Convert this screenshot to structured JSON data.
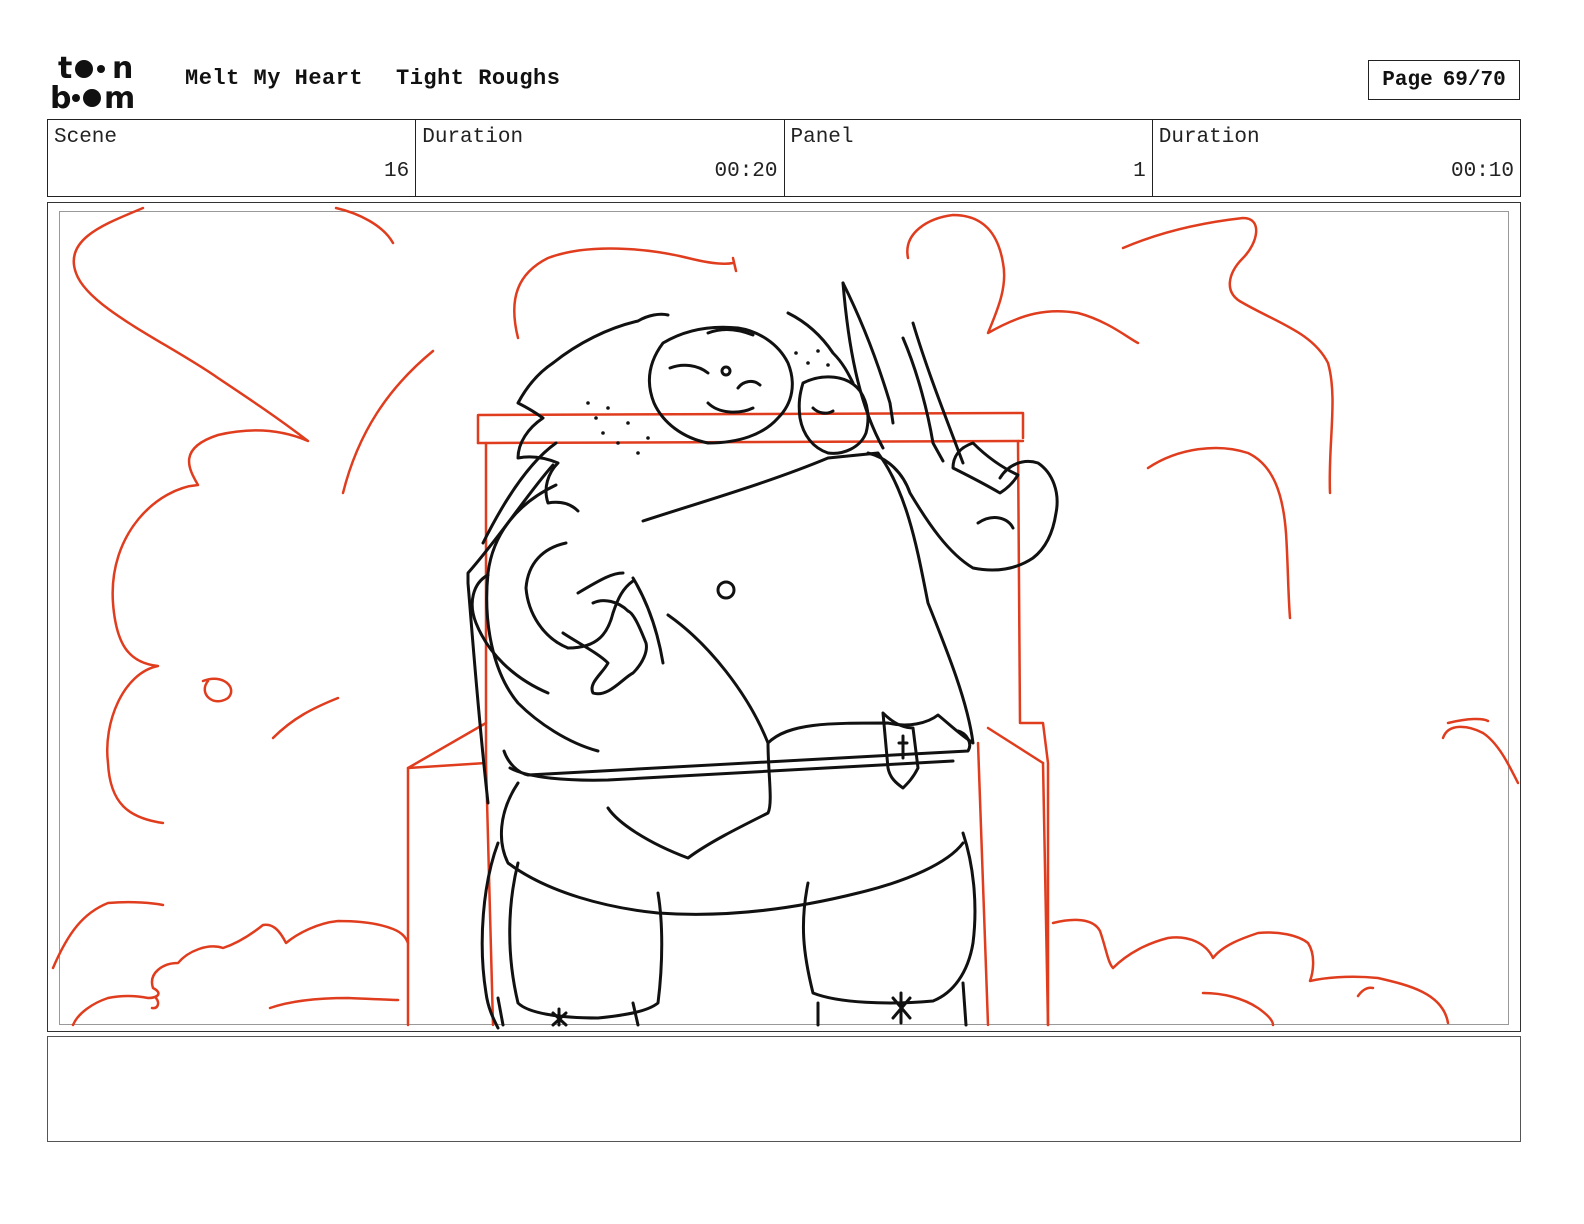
{
  "header": {
    "logo_alt": "toon boom",
    "project_title": "Melt My Heart",
    "sequence_title": "Tight Roughs",
    "page_label": "Page",
    "page_number": "69/70"
  },
  "info": {
    "scene_label": "Scene",
    "scene_value": "16",
    "scene_duration_label": "Duration",
    "scene_duration_value": "00:20",
    "panel_label": "Panel",
    "panel_value": "1",
    "panel_duration_label": "Duration",
    "panel_duration_value": "00:10"
  },
  "colors": {
    "sketch_red": "#e03c1e",
    "ink": "#111111"
  },
  "notes": {
    "text": ""
  }
}
